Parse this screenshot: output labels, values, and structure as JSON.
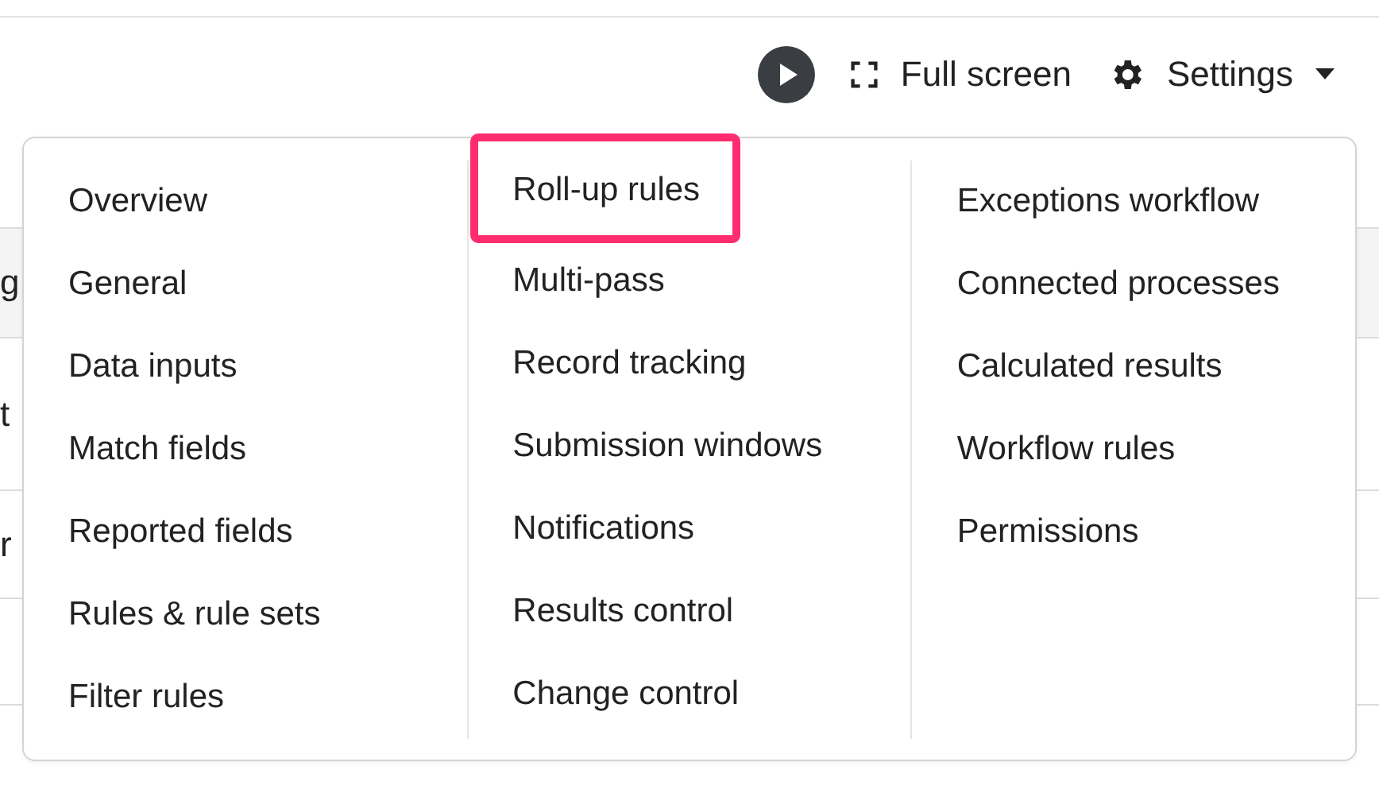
{
  "toolbar": {
    "full_screen_label": "Full screen",
    "settings_label": "Settings"
  },
  "table": {
    "header": "g",
    "rows": [
      "t",
      "r",
      null
    ]
  },
  "settings_menu": {
    "columns": [
      {
        "items": [
          {
            "label": "Overview",
            "highlighted": false
          },
          {
            "label": "General",
            "highlighted": false
          },
          {
            "label": "Data inputs",
            "highlighted": false
          },
          {
            "label": "Match fields",
            "highlighted": false
          },
          {
            "label": "Reported fields",
            "highlighted": false
          },
          {
            "label": "Rules & rule sets",
            "highlighted": false
          },
          {
            "label": "Filter rules",
            "highlighted": false
          }
        ]
      },
      {
        "items": [
          {
            "label": "Roll-up rules",
            "highlighted": true
          },
          {
            "label": "Multi-pass",
            "highlighted": false
          },
          {
            "label": "Record tracking",
            "highlighted": false
          },
          {
            "label": "Submission windows",
            "highlighted": false
          },
          {
            "label": "Notifications",
            "highlighted": false
          },
          {
            "label": "Results control",
            "highlighted": false
          },
          {
            "label": "Change control",
            "highlighted": false
          }
        ]
      },
      {
        "items": [
          {
            "label": "Exceptions workflow",
            "highlighted": false
          },
          {
            "label": "Connected processes",
            "highlighted": false
          },
          {
            "label": "Calculated results",
            "highlighted": false
          },
          {
            "label": "Workflow rules",
            "highlighted": false
          },
          {
            "label": "Permissions",
            "highlighted": false
          }
        ]
      }
    ]
  }
}
